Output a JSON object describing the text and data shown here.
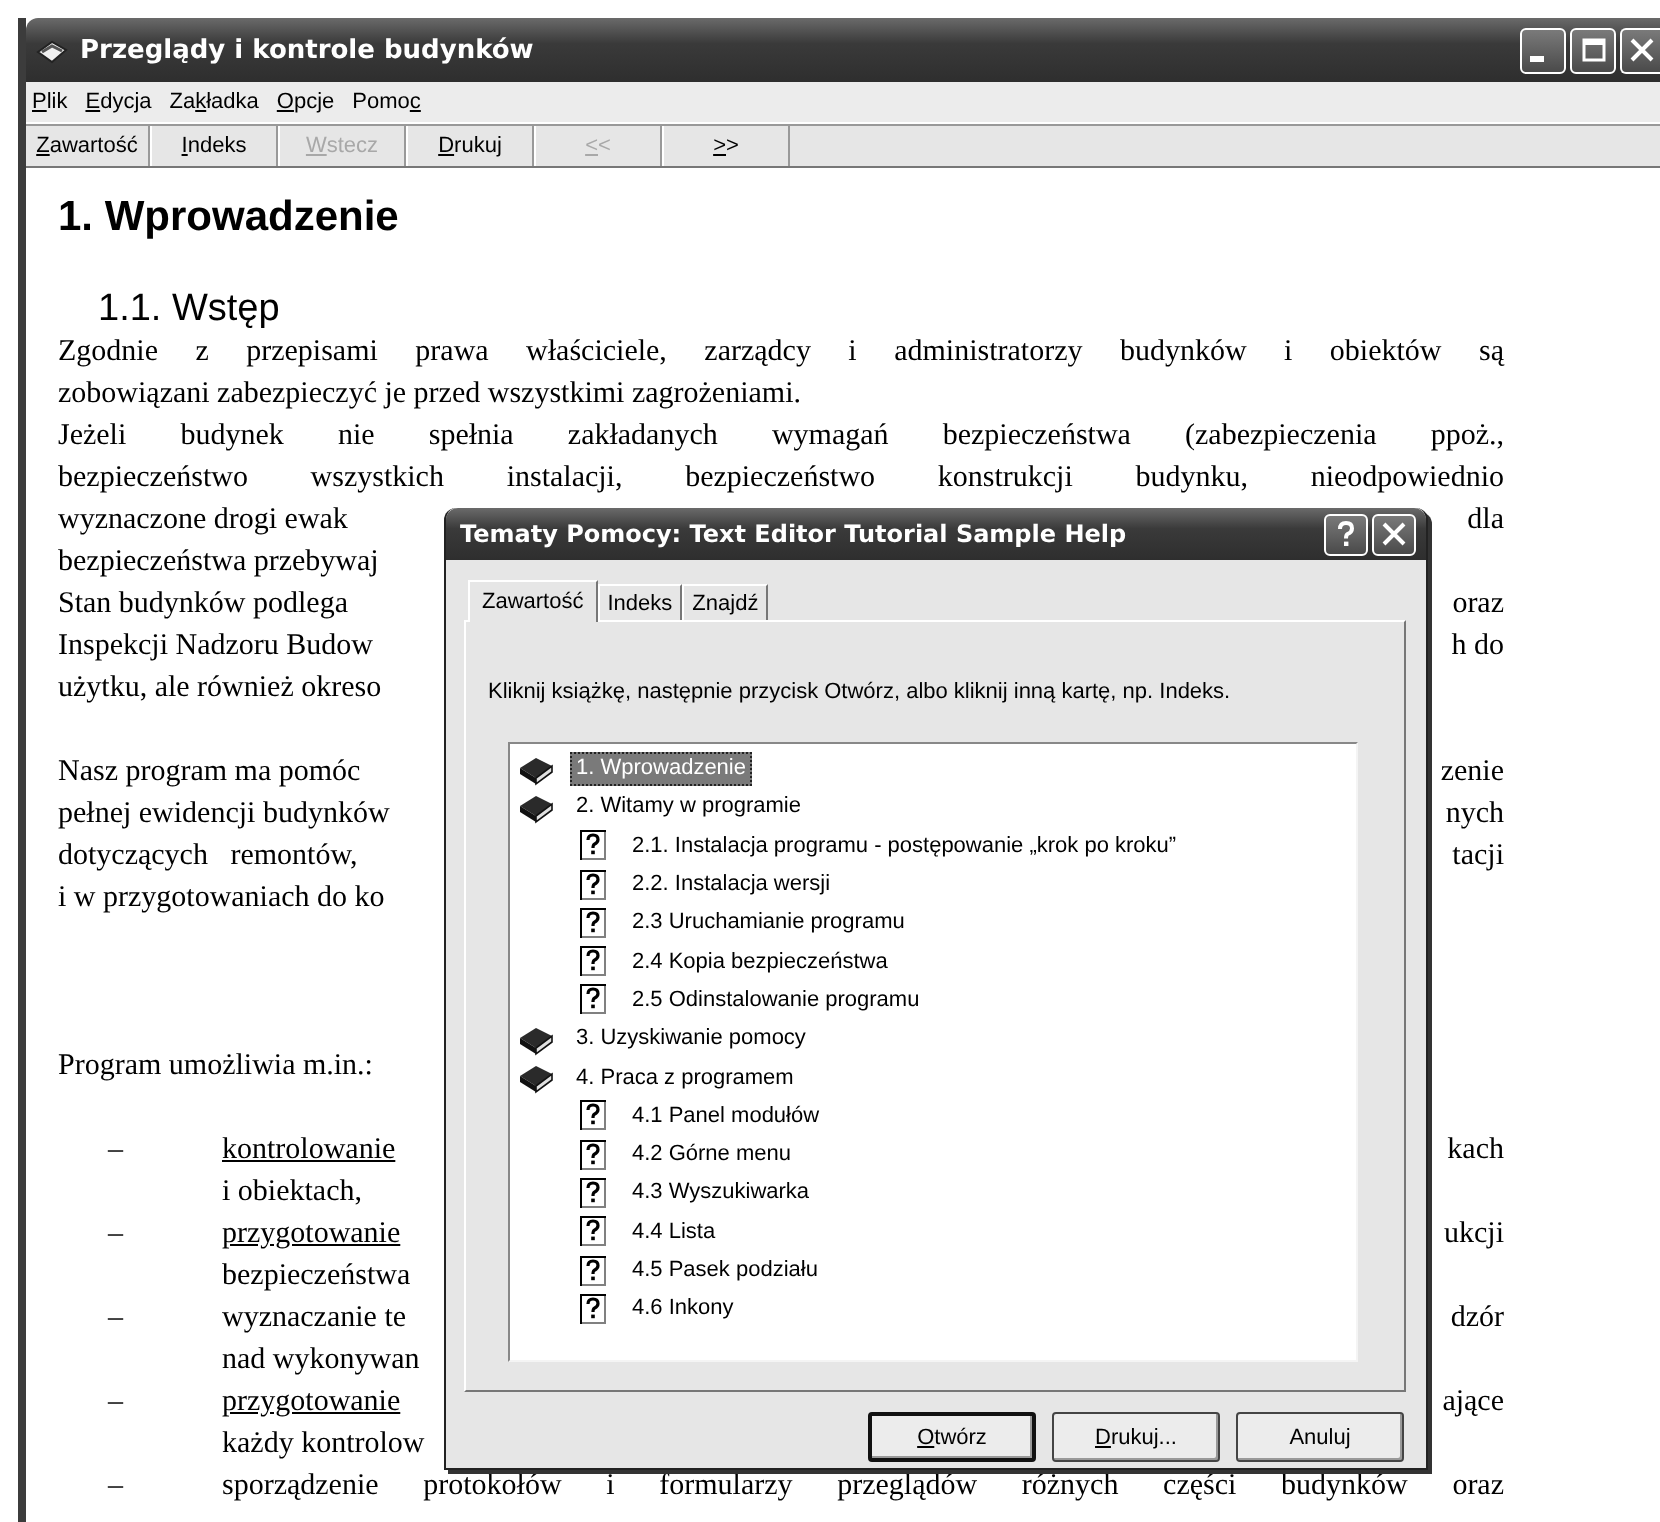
{
  "window": {
    "title": "Przeglądy i kontrole budynków"
  },
  "menu": [
    {
      "accel": "P",
      "rest": "lik"
    },
    {
      "accel": "E",
      "rest": "dycja"
    },
    {
      "pre": "Za",
      "accel": "k",
      "rest": "ładka"
    },
    {
      "accel": "O",
      "rest": "pcje"
    },
    {
      "pre": "Pomo",
      "accel": "c"
    }
  ],
  "toolbar": [
    {
      "accel": "Z",
      "rest": "awartość",
      "disabled": false
    },
    {
      "accel": "I",
      "rest": "ndeks",
      "disabled": false
    },
    {
      "accel": "W",
      "rest": "stecz",
      "disabled": true
    },
    {
      "accel": "D",
      "rest": "rukuj",
      "disabled": false
    },
    {
      "accel": "<",
      "rest": "<",
      "disabled": true
    },
    {
      "accel": ">",
      "rest": ">",
      "disabled": false
    }
  ],
  "document": {
    "heading": "1. Wprowadzenie",
    "subheading": "1.1. Wstęp",
    "lines": [
      {
        "kind": "full",
        "left": "Zgodnie z przepisami prawa właściciele, zarządcy i administratorzy budynków i obiektów są"
      },
      {
        "kind": "part",
        "left": "zobowiązani zabezpieczyć je przed wszystkimi zagrożeniami."
      },
      {
        "kind": "full",
        "left": "Jeżeli budynek nie spełnia zakładanych wymagań bezpieczeństwa (zabezpieczenia ppoż.,"
      },
      {
        "kind": "full",
        "left": "bezpieczeństwo wszystkich instalacji, bezpieczeństwo konstrukcji budynku, nieodpowiednio"
      },
      {
        "kind": "part",
        "left": "wyznaczone drogi ewak",
        "right": "dla"
      },
      {
        "kind": "part",
        "left": "bezpieczeństwa przebywaj"
      },
      {
        "kind": "part",
        "left": "Stan budynków podlega",
        "right": "oraz"
      },
      {
        "kind": "part",
        "left": "Inspekcji Nadzoru Budow",
        "right": "h do"
      },
      {
        "kind": "part",
        "left": "użytku, ale również okreso"
      },
      {
        "kind": "blank"
      },
      {
        "kind": "part",
        "left": "Nasz program ma pomóc",
        "right": "zenie"
      },
      {
        "kind": "part",
        "left": "pełnej ewidencji budynków",
        "right": "nych"
      },
      {
        "kind": "part",
        "left": "dotyczących   remontów,",
        "right": "tacji"
      },
      {
        "kind": "part",
        "left": "i w przygotowaniach do ko"
      },
      {
        "kind": "blank"
      },
      {
        "kind": "blank"
      },
      {
        "kind": "blank"
      },
      {
        "kind": "part",
        "left": "Program umożliwia m.in.:"
      },
      {
        "kind": "blank"
      },
      {
        "kind": "bullet",
        "dash": "–",
        "left": "kontrolowanie",
        "link": true,
        "right": "kach",
        "full": false
      },
      {
        "kind": "indent",
        "left": "i obiektach,"
      },
      {
        "kind": "bullet",
        "dash": "–",
        "left": "przygotowanie",
        "link": true,
        "right": "ukcji",
        "full": false
      },
      {
        "kind": "indent",
        "left": "bezpieczeństwa"
      },
      {
        "kind": "bullet",
        "dash": "–",
        "left": "wyznaczanie te",
        "link": false,
        "right": "dzór",
        "full": false
      },
      {
        "kind": "indent",
        "left": "nad wykonywan"
      },
      {
        "kind": "bullet",
        "dash": "–",
        "left": "przygotowanie",
        "link": true,
        "right": "ające",
        "full": false
      },
      {
        "kind": "indent",
        "left": "każdy kontrolow"
      },
      {
        "kind": "bullet",
        "dash": "–",
        "left": "sporządzenie protokołów i formularzy przeglądów różnych części budynków oraz",
        "link": false,
        "full": true
      }
    ]
  },
  "dialog": {
    "title": "Tematy Pomocy: Text Editor Tutorial Sample Help",
    "tabs": [
      {
        "label": "Zawartość",
        "selected": true
      },
      {
        "label": "Indeks",
        "selected": false
      },
      {
        "label": "Znajdź",
        "selected": false
      }
    ],
    "instruction": "Kliknij książkę, następnie przycisk Otwórz, albo kliknij inną kartę, np. Indeks.",
    "tree": [
      {
        "kind": "book",
        "label": "1. Wprowadzenie",
        "selected": true
      },
      {
        "kind": "book",
        "label": "2. Witamy w programie",
        "selected": false,
        "children": [
          {
            "kind": "page",
            "label": "2.1. Instalacja programu - postępowanie „krok po kroku”",
            "selected": false
          },
          {
            "kind": "page",
            "label": "2.2. Instalacja wersji",
            "selected": false
          },
          {
            "kind": "page",
            "label": "2.3 Uruchamianie programu",
            "selected": false
          },
          {
            "kind": "page",
            "label": "2.4 Kopia bezpieczeństwa",
            "selected": false
          },
          {
            "kind": "page",
            "label": "2.5 Odinstalowanie programu",
            "selected": false
          }
        ]
      },
      {
        "kind": "book",
        "label": "3. Uzyskiwanie pomocy",
        "selected": false
      },
      {
        "kind": "book",
        "label": "4. Praca z programem",
        "selected": false,
        "children": [
          {
            "kind": "page",
            "label": "4.1 Panel modułów",
            "selected": false
          },
          {
            "kind": "page",
            "label": "4.2 Górne menu",
            "selected": false
          },
          {
            "kind": "page",
            "label": "4.3 Wyszukiwarka",
            "selected": false
          },
          {
            "kind": "page",
            "label": "4.4 Lista",
            "selected": false
          },
          {
            "kind": "page",
            "label": "4.5 Pasek podziału",
            "selected": false
          },
          {
            "kind": "page",
            "label": "4.6 Inkony",
            "selected": false
          }
        ]
      }
    ],
    "buttons": [
      {
        "accel": "O",
        "rest": "twórz",
        "default": true
      },
      {
        "accel": "D",
        "rest": "rukuj...",
        "default": false
      },
      {
        "label": "Anuluj",
        "default": false
      }
    ]
  }
}
